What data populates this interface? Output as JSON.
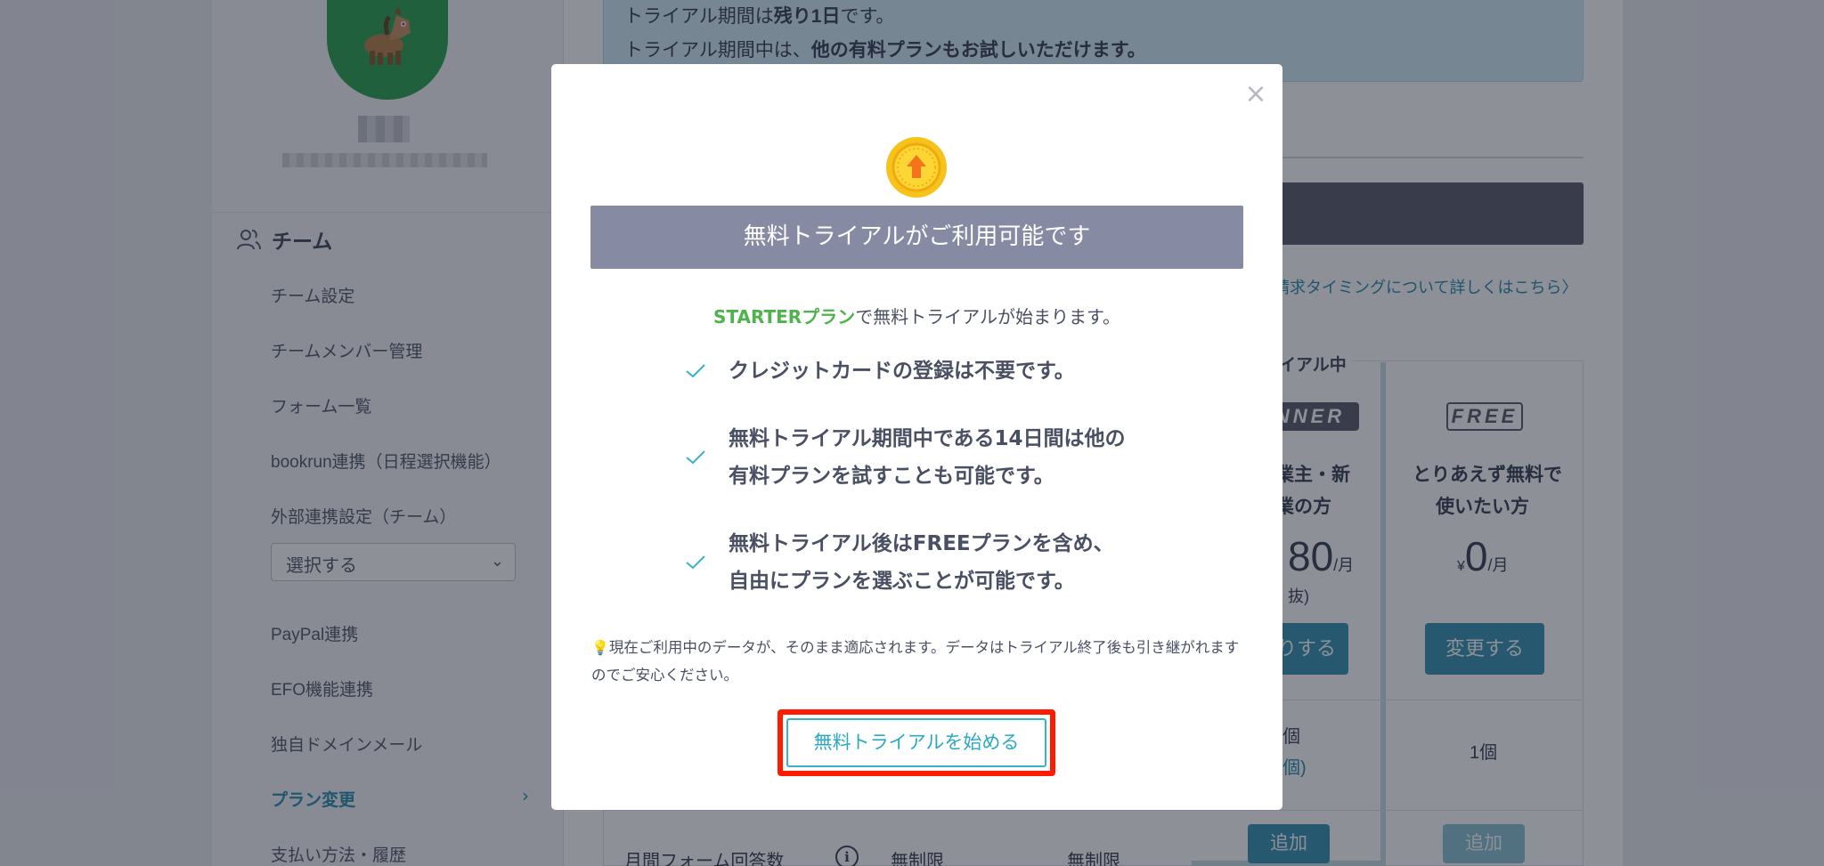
{
  "background": {
    "sidebar": {
      "section_title": "チーム",
      "items": [
        {
          "label": "チーム設定"
        },
        {
          "label": "チームメンバー管理"
        },
        {
          "label": "フォーム一覧"
        },
        {
          "label": "bookrun連携（日程選択機能）"
        },
        {
          "label": "外部連携設定（チーム）"
        },
        {
          "label": "PayPal連携"
        },
        {
          "label": "EFO機能連携"
        },
        {
          "label": "独自ドメインメール"
        },
        {
          "label": "プラン変更"
        },
        {
          "label": "支払い方法・履歴"
        }
      ],
      "select_value": "選択する",
      "active_chevron": "›"
    },
    "banner": {
      "line1_prefix": "トライアル期間は",
      "line1_bold": "残り1日",
      "line1_suffix": "です。",
      "line2_prefix": "トライアル期間中は、",
      "line2_bold": "他の有料プランもお試しいただけます。"
    },
    "billing_link": "請求タイミングについて詳しくはこちら",
    "billing_link_chevron": "〉",
    "plans": {
      "trial_label": "イアル中",
      "winner_badge": "NNER",
      "free_badge": "FREE",
      "winner_desc_1": "業主・新",
      "winner_desc_2": "業の方",
      "free_desc_1": "とりあえず無料で",
      "free_desc_2": "使いたい方",
      "winner_price": "80",
      "winner_price_unit": "/月",
      "winner_tax": "抜)",
      "free_price_yen": "¥",
      "free_price": "0",
      "free_price_unit": "/月",
      "winner_button": "りする",
      "free_button": "変更する",
      "row1_winner_1": "個",
      "row1_winner_2": "個)",
      "row1_free": "1個",
      "add_winner": "追加",
      "add_free": "追加",
      "row2_label": "月間フォーム回答数",
      "row2_info": "i",
      "row2_col1": "無制限",
      "row2_col2": "無制限"
    }
  },
  "modal": {
    "close": "×",
    "title": "無料トライアルがご利用可能です",
    "intro_plan": "STARTERプラン",
    "intro_suffix": "で無料トライアルが始まります。",
    "features": [
      {
        "line1": "クレジットカードの登録は不要です。",
        "line2": ""
      },
      {
        "line1": "無料トライアル期間中である14日間は他の",
        "line2": "有料プランを試すことも可能です。"
      },
      {
        "line1": "無料トライアル後はFREEプランを含め、",
        "line2": "自由にプランを選ぶことが可能です。"
      }
    ],
    "note": "現在ご利用中のデータが、そのまま適応されます。データはトライアル終了後も引き継がれますのでご安心ください。",
    "cta": "無料トライアルを始める"
  },
  "colors": {
    "accent_teal": "#2aa9c4",
    "plan_green": "#4fb34b",
    "highlight_red": "#ff1a00",
    "title_bg": "#878aa3"
  }
}
